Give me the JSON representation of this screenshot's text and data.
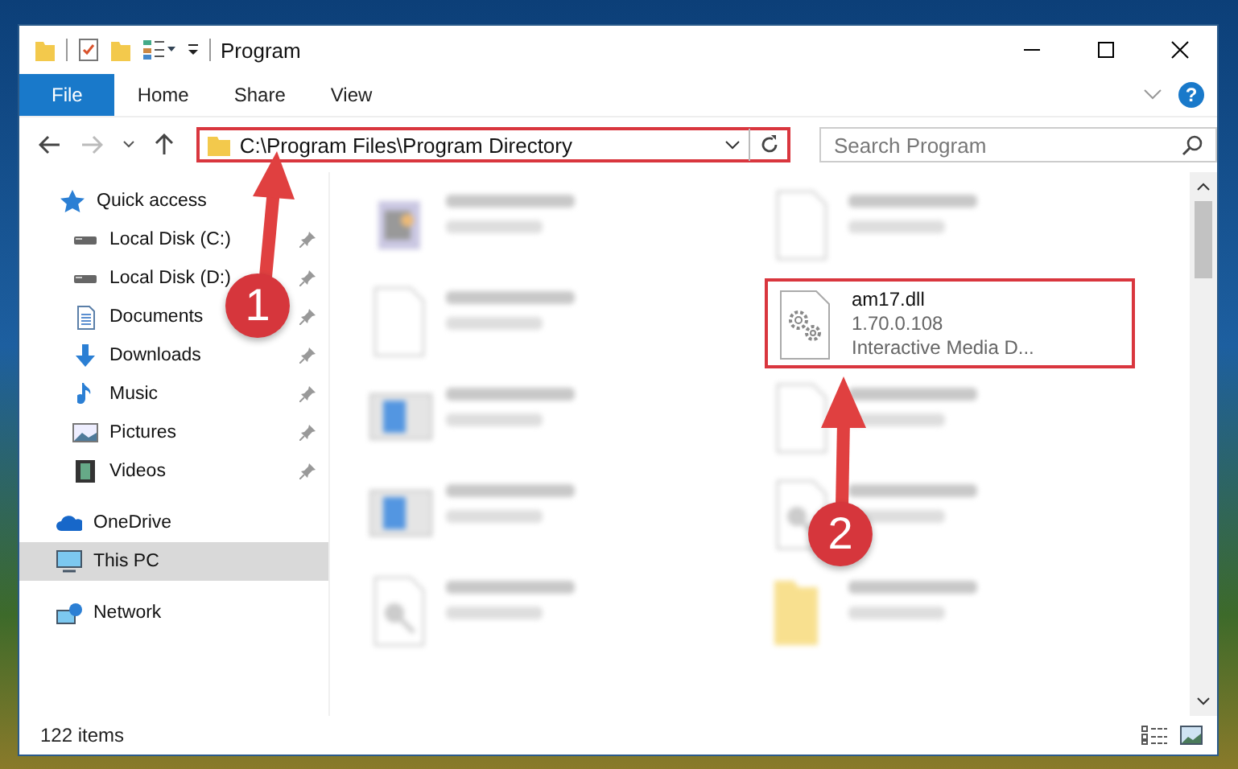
{
  "window": {
    "title": "Program"
  },
  "ribbon_tabs": [
    {
      "label": "File",
      "selected": true
    },
    {
      "label": "Home",
      "selected": false
    },
    {
      "label": "Share",
      "selected": false
    },
    {
      "label": "View",
      "selected": false
    }
  ],
  "help": "?",
  "address": {
    "path": "C:\\Program Files\\Program Directory",
    "highlighted": true
  },
  "search": {
    "placeholder": "Search Program"
  },
  "nav": [
    {
      "label": "Quick access",
      "kind": "star",
      "pinned": false,
      "selected": false
    },
    {
      "label": "Local Disk (C:)",
      "kind": "drive",
      "pinned": true,
      "selected": false
    },
    {
      "label": "Local Disk (D:)",
      "kind": "drive",
      "pinned": true,
      "selected": false
    },
    {
      "label": "Documents",
      "kind": "document",
      "pinned": true,
      "selected": false
    },
    {
      "label": "Downloads",
      "kind": "download",
      "pinned": true,
      "selected": false
    },
    {
      "label": "Music",
      "kind": "music",
      "pinned": true,
      "selected": false
    },
    {
      "label": "Pictures",
      "kind": "pictures",
      "pinned": true,
      "selected": false
    },
    {
      "label": "Videos",
      "kind": "videos",
      "pinned": true,
      "selected": false
    },
    {
      "label": "OneDrive",
      "kind": "cloud",
      "pinned": false,
      "selected": false
    },
    {
      "label": "This PC",
      "kind": "pc",
      "pinned": false,
      "selected": true
    },
    {
      "label": "Network",
      "kind": "network",
      "pinned": false,
      "selected": false
    }
  ],
  "files": [
    {
      "kind": "app",
      "blurred": true,
      "highlighted": false
    },
    {
      "kind": "blank",
      "blurred": true,
      "highlighted": false
    },
    {
      "kind": "blank",
      "blurred": true,
      "highlighted": false
    },
    {
      "name": "am17.dll",
      "details": [
        "1.70.0.108",
        "Interactive Media D..."
      ],
      "kind": "gear",
      "blurred": false,
      "highlighted": true
    },
    {
      "kind": "installer",
      "blurred": true,
      "highlighted": false
    },
    {
      "kind": "blank",
      "blurred": true,
      "highlighted": false
    },
    {
      "kind": "installer",
      "blurred": true,
      "highlighted": false
    },
    {
      "kind": "dll",
      "blurred": true,
      "highlighted": false
    },
    {
      "kind": "dll",
      "blurred": true,
      "highlighted": false
    },
    {
      "kind": "folder",
      "blurred": true,
      "highlighted": false
    }
  ],
  "status_bar": {
    "count": "122 items"
  },
  "callouts": [
    {
      "number": "1"
    },
    {
      "number": "2"
    }
  ]
}
